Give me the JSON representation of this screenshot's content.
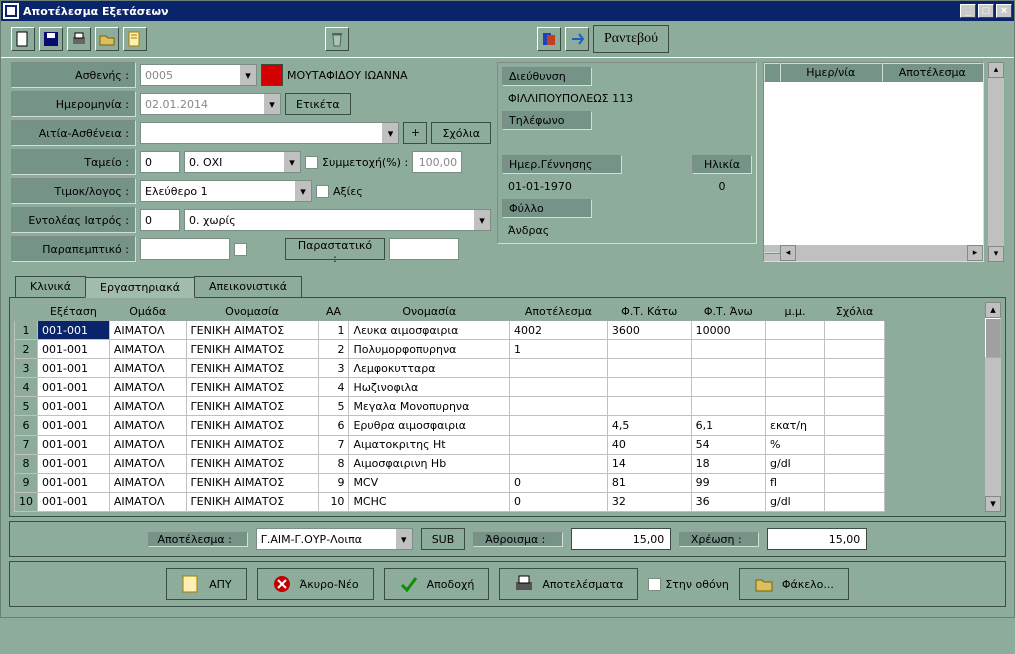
{
  "window": {
    "title": "Αποτέλεσμα Εξετάσεων"
  },
  "toolbar": {
    "icons": [
      "new",
      "save",
      "print",
      "open",
      "form",
      "trash",
      "blue1",
      "blue2"
    ],
    "appointment": "Ραντεβού"
  },
  "form": {
    "patient_label": "Ασθενής :",
    "patient_code": "0005",
    "patient_name": "ΜΟΥΤΑΦΙΔΟΥ ΙΩΑΝΝΑ",
    "date_label": "Ημερομηνία :",
    "date_value": "02.01.2014",
    "label_btn": "Ετικέτα",
    "cause_label": "Αιτία-Ασθένεια :",
    "plus": "+",
    "comments_btn": "Σχόλια",
    "fund_label": "Ταμείο :",
    "fund_code": "0",
    "fund_name": "0. ΟΧΙ",
    "part_label": "Συμμετοχή(%) :",
    "part_value": "100,00",
    "pricelist_label": "Τιμοκ/λογος :",
    "pricelist_value": "Ελεύθερο 1",
    "values_chk": "Αξίες",
    "doctor_label": "Εντολέας Ιατρός :",
    "doctor_code": "0",
    "doctor_name": "0. χωρίς",
    "referral_label": "Παραπεμπτικό :",
    "document_label": "Παραστατικό :"
  },
  "info": {
    "addr_label": "Διεύθυνση",
    "addr_value": "ΦΙΛΛΙΠΟΥΠΟΛΕΩΣ  113",
    "tel_label": "Τηλέφωνο",
    "dob_label": "Ημερ.Γέννησης",
    "age_label": "Ηλικία",
    "dob_value": "01-01-1970",
    "age_value": "0",
    "sex_label": "Φύλλο",
    "sex_value": "Άνδρας"
  },
  "side": {
    "col_date": "Ημερ/νία",
    "col_result": "Αποτέλεσμα"
  },
  "tabs": {
    "clinical": "Κλινικά",
    "laboratory": "Εργαστηριακά",
    "imaging": "Απεικονιστικά"
  },
  "grid": {
    "columns": [
      "",
      "Εξέταση",
      "Ομάδα",
      "Ονομασία",
      "ΑΑ",
      "Ονομασία",
      "Αποτέλεσμα",
      "Φ.Τ. Κάτω",
      "Φ.Τ. Άνω",
      "μ.μ.",
      "Σχόλια"
    ],
    "rows": [
      {
        "n": "1",
        "exam": "001-001",
        "group": "ΑΙΜΑΤΟΛ",
        "name": "ΓΕΝΙΚΗ ΑΙΜΑΤΟΣ",
        "aa": "1",
        "name2": "Λευκα αιμοσφαιρια",
        "result": "4002",
        "low": "3600",
        "high": "10000",
        "unit": "",
        "note": ""
      },
      {
        "n": "2",
        "exam": "001-001",
        "group": "ΑΙΜΑΤΟΛ",
        "name": "ΓΕΝΙΚΗ ΑΙΜΑΤΟΣ",
        "aa": "2",
        "name2": "Πολυμορφοπυρηνα",
        "result": "1",
        "low": "",
        "high": "",
        "unit": "",
        "note": ""
      },
      {
        "n": "3",
        "exam": "001-001",
        "group": "ΑΙΜΑΤΟΛ",
        "name": "ΓΕΝΙΚΗ ΑΙΜΑΤΟΣ",
        "aa": "3",
        "name2": "Λεμφοκυτταρα",
        "result": "",
        "low": "",
        "high": "",
        "unit": "",
        "note": ""
      },
      {
        "n": "4",
        "exam": "001-001",
        "group": "ΑΙΜΑΤΟΛ",
        "name": "ΓΕΝΙΚΗ ΑΙΜΑΤΟΣ",
        "aa": "4",
        "name2": "Ηωζινοφιλα",
        "result": "",
        "low": "",
        "high": "",
        "unit": "",
        "note": ""
      },
      {
        "n": "5",
        "exam": "001-001",
        "group": "ΑΙΜΑΤΟΛ",
        "name": "ΓΕΝΙΚΗ ΑΙΜΑΤΟΣ",
        "aa": "5",
        "name2": "Μεγαλα Μονοπυρηνα",
        "result": "",
        "low": "",
        "high": "",
        "unit": "",
        "note": ""
      },
      {
        "n": "6",
        "exam": "001-001",
        "group": "ΑΙΜΑΤΟΛ",
        "name": "ΓΕΝΙΚΗ ΑΙΜΑΤΟΣ",
        "aa": "6",
        "name2": "Ερυθρα αιμοσφαιρια",
        "result": "",
        "low": "4,5",
        "high": "6,1",
        "unit": "εκατ/η",
        "note": ""
      },
      {
        "n": "7",
        "exam": "001-001",
        "group": "ΑΙΜΑΤΟΛ",
        "name": "ΓΕΝΙΚΗ ΑΙΜΑΤΟΣ",
        "aa": "7",
        "name2": "Αιματοκριτης Ht",
        "result": "",
        "low": "40",
        "high": "54",
        "unit": "%",
        "note": ""
      },
      {
        "n": "8",
        "exam": "001-001",
        "group": "ΑΙΜΑΤΟΛ",
        "name": "ΓΕΝΙΚΗ ΑΙΜΑΤΟΣ",
        "aa": "8",
        "name2": "Αιμοσφαιρινη Hb",
        "result": "",
        "low": "14",
        "high": "18",
        "unit": "g/dl",
        "note": ""
      },
      {
        "n": "9",
        "exam": "001-001",
        "group": "ΑΙΜΑΤΟΛ",
        "name": "ΓΕΝΙΚΗ ΑΙΜΑΤΟΣ",
        "aa": "9",
        "name2": "MCV",
        "result": "0",
        "low": "81",
        "high": "99",
        "unit": "fl",
        "note": ""
      },
      {
        "n": "10",
        "exam": "001-001",
        "group": "ΑΙΜΑΤΟΛ",
        "name": "ΓΕΝΙΚΗ ΑΙΜΑΤΟΣ",
        "aa": "10",
        "name2": "MCHC",
        "result": "0",
        "low": "32",
        "high": "36",
        "unit": "g/dl",
        "note": ""
      }
    ]
  },
  "summary": {
    "result_label": "Αποτέλεσμα :",
    "result_value": "Γ.ΑΙΜ-Γ.ΟΥΡ-Λοιπα",
    "sub_btn": "SUB",
    "sum_label": "Άθροισμα :",
    "sum_value": "15,00",
    "charge_label": "Χρέωση :",
    "charge_value": "15,00"
  },
  "actions": {
    "apy": "ΑΠΥ",
    "cancel_new": "Άκυρο-Νέο",
    "accept": "Αποδοχή",
    "results": "Αποτελέσματα",
    "onscreen": "Στην οθόνη",
    "file": "Φάκελο..."
  }
}
